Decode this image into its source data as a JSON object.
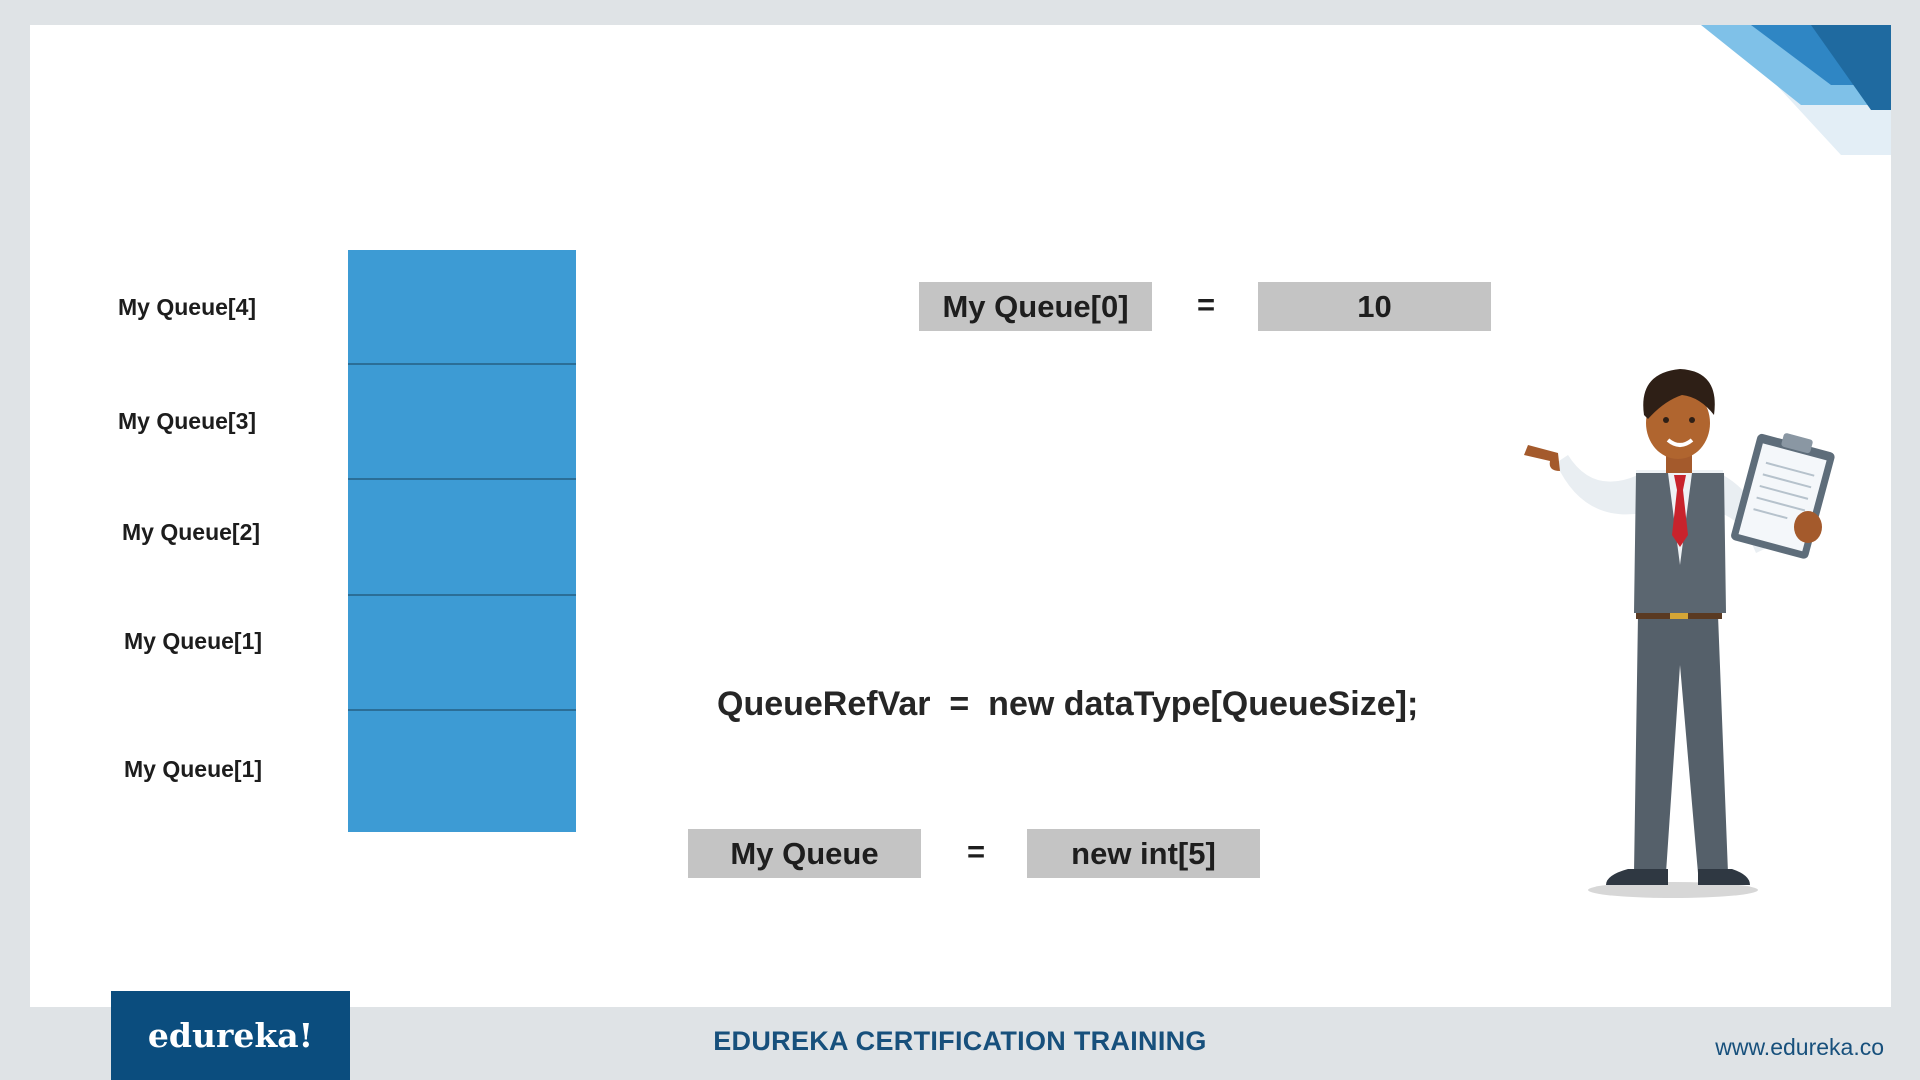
{
  "queue": {
    "labels": [
      "My Queue[4]",
      "My Queue[3]",
      "My Queue[2]",
      "My Queue[1]",
      "My Queue[1]"
    ]
  },
  "assignment": {
    "left": "My Queue[0]",
    "equals": "=",
    "right": "10"
  },
  "syntax": "QueueRefVar  =  new dataType[QueueSize];",
  "declaration": {
    "left": "My Queue",
    "equals": "=",
    "right": "new int[5]"
  },
  "footer": {
    "logo": "edureka!",
    "title": "EDUREKA CERTIFICATION TRAINING",
    "url": "www.edureka.co"
  },
  "colors": {
    "cell_fill": "#3d9bd4",
    "box_fill": "#c4c4c4",
    "brand_blue": "#0b4d7e"
  }
}
